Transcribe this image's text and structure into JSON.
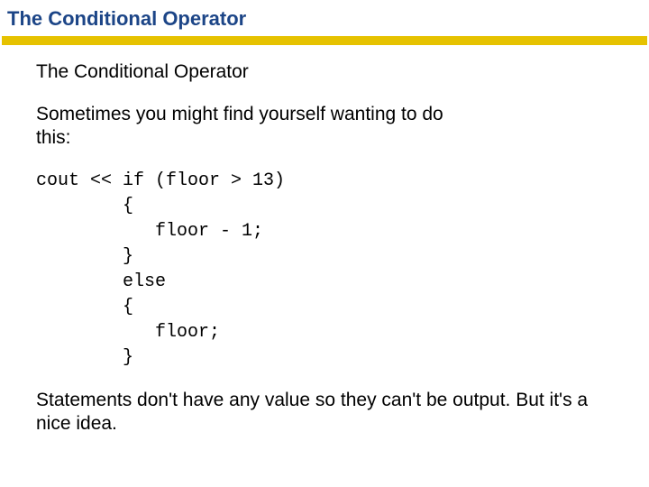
{
  "header": {
    "title": "The Conditional Operator"
  },
  "content": {
    "subtitle": "The Conditional Operator",
    "intro": "Sometimes you might find yourself wanting to do this:",
    "code": "cout << if (floor > 13)\n        {\n           floor - 1;\n        }\n        else\n        {\n           floor;\n        }",
    "closing": "Statements don't have any value so they can't be output. But it's a nice idea."
  }
}
